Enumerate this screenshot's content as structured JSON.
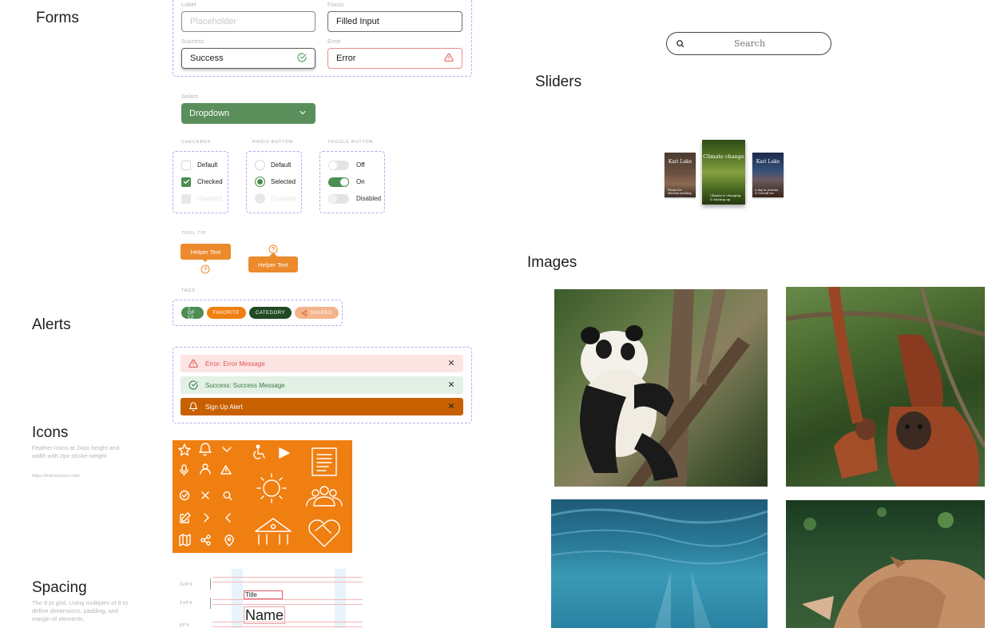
{
  "sections": {
    "forms": "Forms",
    "alerts": "Alerts",
    "icons": "Icons",
    "spacing": "Spacing",
    "sliders": "Sliders",
    "images": "Images"
  },
  "icons_section": {
    "description": "Feather icons at 24px height and width with 2px stroke weight",
    "link": "https://feathericons.com/"
  },
  "spacing_section": {
    "description": "The 8 pt grid. Using multiples of 8 to define dimensions, padding, and margin of elements.",
    "rows": [
      "32PX",
      "24PX",
      "8PX"
    ],
    "title_sample": "Title",
    "name_sample": "Name"
  },
  "forms": {
    "label_field": {
      "label": "Label",
      "placeholder": "Placeholder"
    },
    "focus_field": {
      "label": "Focus",
      "value": "Filled Input"
    },
    "success_field": {
      "label": "Success",
      "value": "Success"
    },
    "error_field": {
      "label": "Error",
      "value": "Error"
    },
    "select": {
      "label": "Select",
      "value": "Dropdown"
    },
    "checkbox": {
      "heading": "CHECKBOX",
      "options": [
        "Default",
        "Checked",
        "Disabled"
      ]
    },
    "radio": {
      "heading": "RADIO BUTTON",
      "options": [
        "Default",
        "Selected",
        "Disabled"
      ]
    },
    "toggle": {
      "heading": "TOGGLE BUTTON",
      "options": [
        "Off",
        "On",
        "Disabled"
      ]
    },
    "tooltip": {
      "heading": "TOOL TIP",
      "text1": "Helper Text",
      "text2": "Helper Text"
    },
    "tags": {
      "heading": "TAGS",
      "items": [
        "1 OF 12",
        "FAVORITE",
        "CATEGORY",
        "SHARED"
      ]
    }
  },
  "alerts": {
    "error": "Error: Error Message",
    "success": "Success: Success Message",
    "signup": "Sign Up Alert"
  },
  "search": {
    "placeholder": "Search"
  },
  "slider": {
    "cards": [
      {
        "title": "Kari Lake",
        "caption": "Phone for election meeting",
        "selected": false
      },
      {
        "title": "Climate change",
        "caption": "Climate is changing & heating up",
        "selected": true
      },
      {
        "title": "Kari Lake",
        "caption": "A day in Arizona & Overall rec",
        "selected": false
      }
    ]
  },
  "images": {
    "items": [
      "panda-photo",
      "orangutan-photo",
      "underwater-photo",
      "rhino-photo"
    ]
  },
  "colors": {
    "primary_green": "#5a8f5c",
    "accent_orange": "#f07f11",
    "dark_orange": "#c85f00",
    "error_red": "#e85a5a",
    "dashed_purple": "#b9a8f0"
  }
}
